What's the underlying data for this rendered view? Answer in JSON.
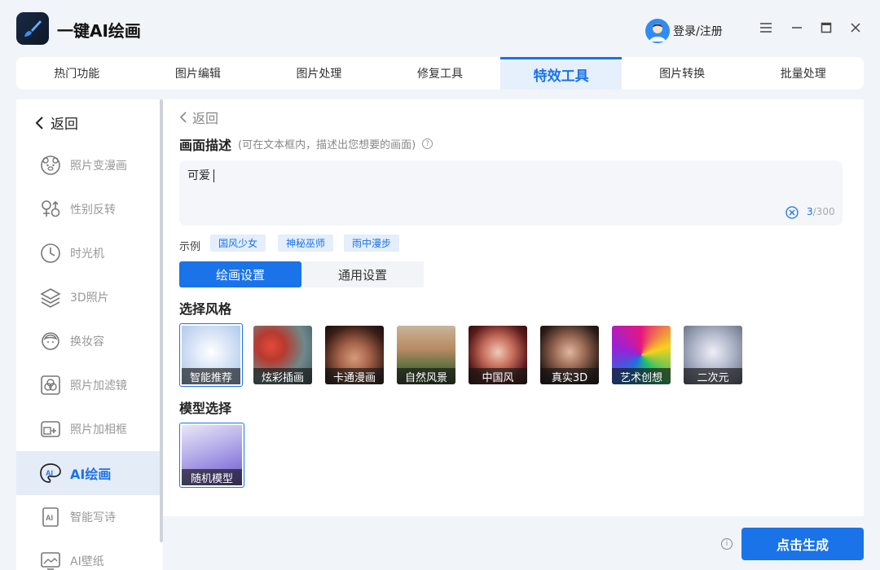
{
  "app": {
    "title": "一键AI绘画",
    "login_label": "登录/注册"
  },
  "tabs": [
    {
      "label": "热门功能"
    },
    {
      "label": "图片编辑"
    },
    {
      "label": "图片处理"
    },
    {
      "label": "修复工具"
    },
    {
      "label": "特效工具",
      "active": true
    },
    {
      "label": "图片转换"
    },
    {
      "label": "批量处理"
    }
  ],
  "sidebar": {
    "back_label": "返回",
    "items": [
      {
        "label": "照片变漫画",
        "icon": "bear-face-icon"
      },
      {
        "label": "性别反转",
        "icon": "gender-icon"
      },
      {
        "label": "时光机",
        "icon": "clock-icon"
      },
      {
        "label": "3D照片",
        "icon": "layers-icon"
      },
      {
        "label": "换妆容",
        "icon": "makeup-face-icon"
      },
      {
        "label": "照片加滤镜",
        "icon": "filter-icon"
      },
      {
        "label": "照片加相框",
        "icon": "frame-icon"
      },
      {
        "label": "AI绘画",
        "icon": "ai-paint-icon",
        "active": true
      },
      {
        "label": "智能写诗",
        "icon": "ai-doc-icon"
      },
      {
        "label": "AI壁纸",
        "icon": "wallpaper-icon"
      }
    ]
  },
  "main": {
    "back_label": "返回",
    "desc_title": "画面描述",
    "desc_hint": "(可在文本框内，描述出您想要的画面)",
    "desc_value": "可爱",
    "char_count": "3",
    "char_max": "/300",
    "examples_label": "示例",
    "examples": [
      "国风少女",
      "神秘巫师",
      "雨中漫步"
    ],
    "settings_tabs": [
      {
        "label": "绘画设置",
        "active": true
      },
      {
        "label": "通用设置"
      }
    ],
    "style_title": "选择风格",
    "styles": [
      {
        "label": "智能推荐",
        "selected": true
      },
      {
        "label": "炫彩插画"
      },
      {
        "label": "卡通漫画"
      },
      {
        "label": "自然风景"
      },
      {
        "label": "中国风"
      },
      {
        "label": "真实3D"
      },
      {
        "label": "艺术创想"
      },
      {
        "label": "二次元"
      }
    ],
    "model_title": "模型选择",
    "models": [
      {
        "label": "随机模型",
        "selected": true
      }
    ]
  },
  "footer": {
    "generate_label": "点击生成"
  },
  "colors": {
    "accent": "#1a73e8",
    "active_bg": "#e4ecf8",
    "chip_bg": "#e4eefc"
  }
}
